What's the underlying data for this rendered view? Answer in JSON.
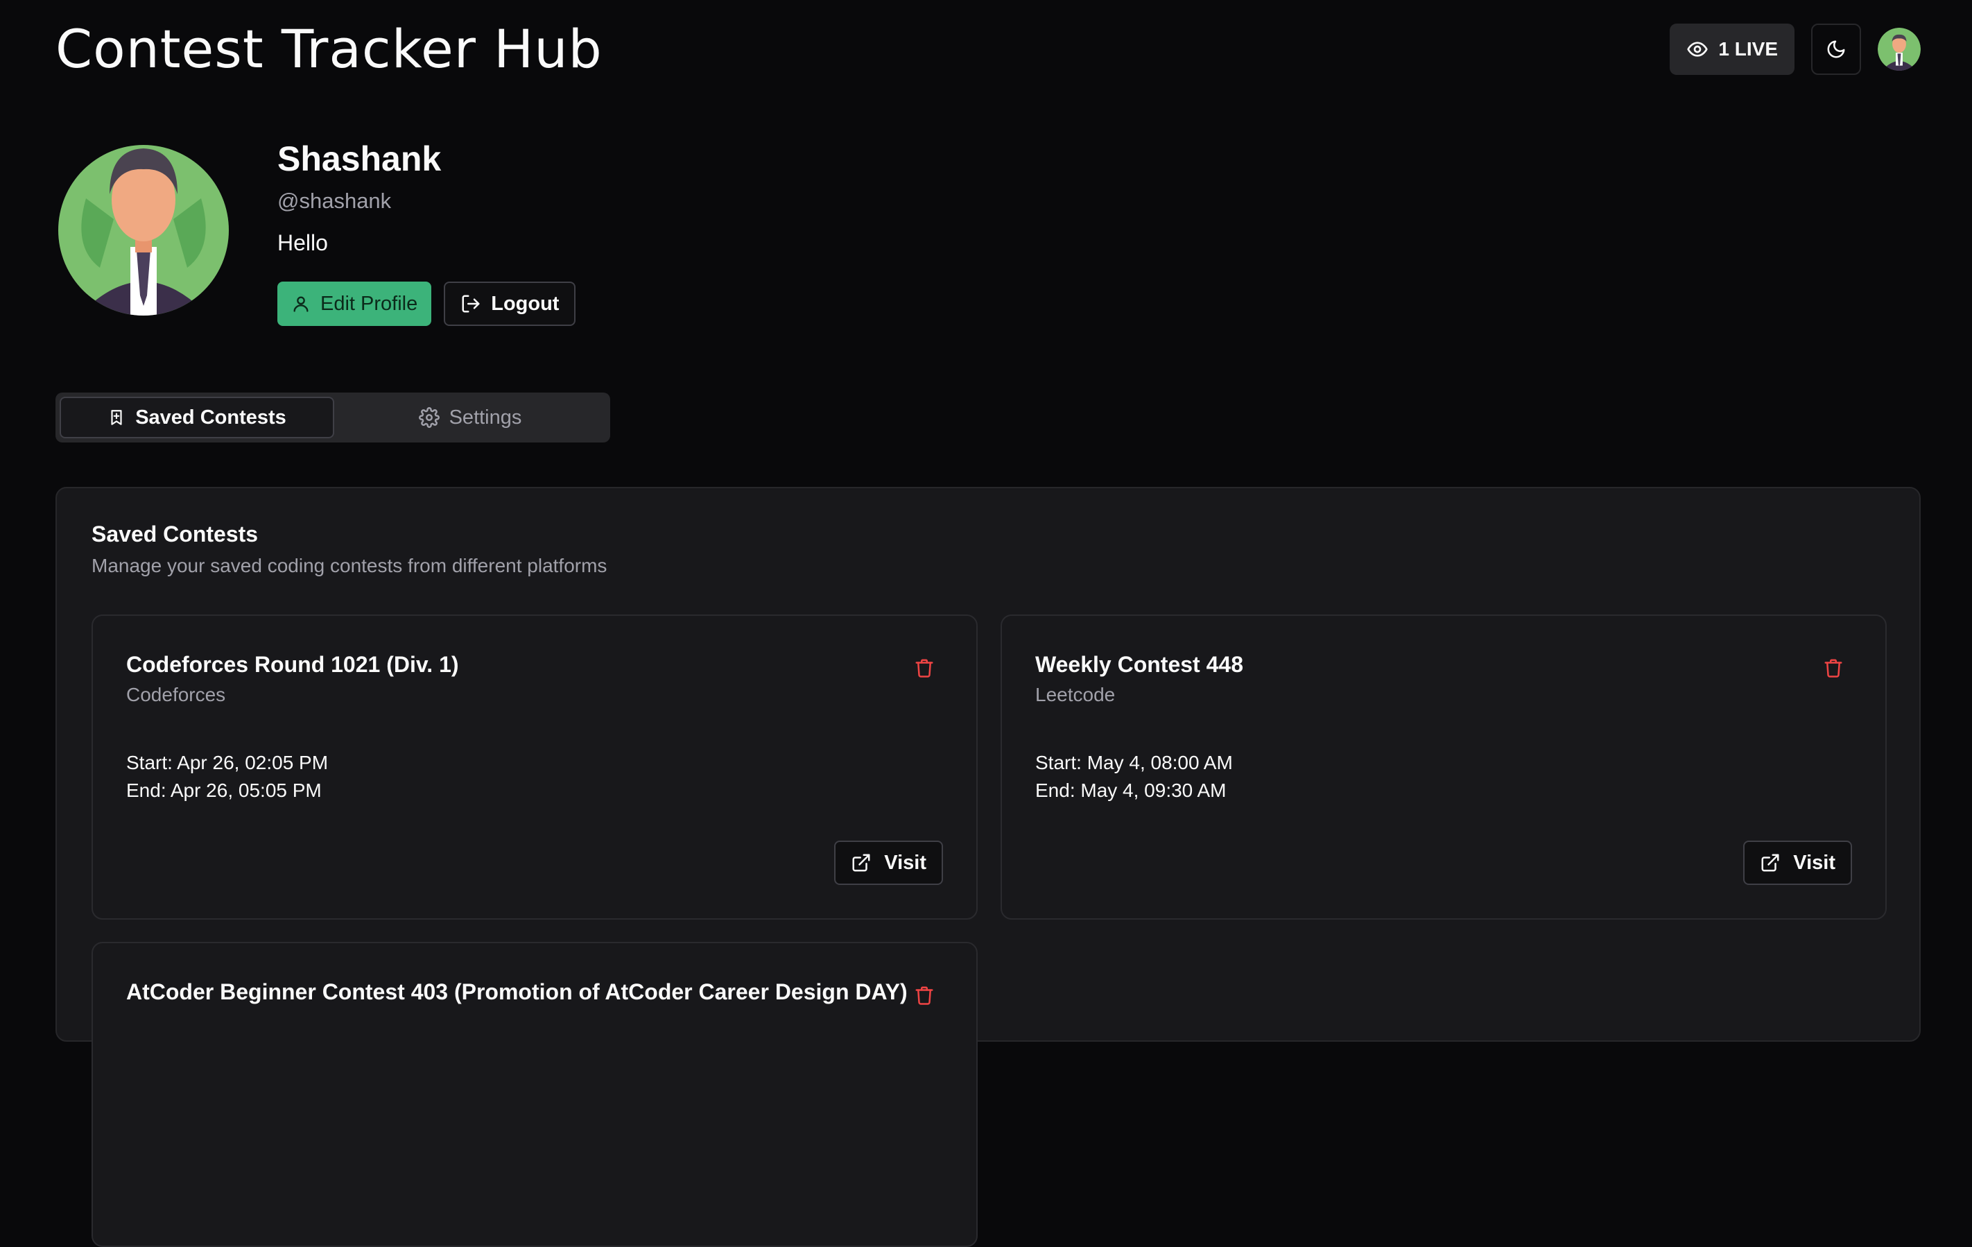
{
  "header": {
    "app_title": "Contest Tracker Hub",
    "live_label": "1 LIVE"
  },
  "profile": {
    "name": "Shashank",
    "handle": "@shashank",
    "bio": "Hello",
    "edit_label": "Edit Profile",
    "logout_label": "Logout"
  },
  "tabs": [
    {
      "label": "Saved Contests",
      "active": true
    },
    {
      "label": "Settings",
      "active": false
    }
  ],
  "saved": {
    "title": "Saved Contests",
    "subtitle": "Manage your saved coding contests from different platforms",
    "cards": [
      {
        "title": "Codeforces Round 1021 (Div. 1)",
        "platform": "Codeforces",
        "start": "Start: Apr 26, 02:05 PM",
        "end": "End: Apr 26, 05:05 PM",
        "visit_label": "Visit"
      },
      {
        "title": "Weekly Contest 448",
        "platform": "Leetcode",
        "start": "Start: May 4, 08:00 AM",
        "end": "End: May 4, 09:30 AM",
        "visit_label": "Visit"
      },
      {
        "title": "AtCoder Beginner Contest 403  (Promotion of AtCoder Career Design DAY)",
        "platform": "",
        "start": "",
        "end": "",
        "visit_label": ""
      }
    ]
  },
  "colors": {
    "background": "#09090b",
    "accent_green": "#3cb37a",
    "trash_red": "#ef4444"
  },
  "icons": {
    "live": "eye-icon",
    "theme": "moon-icon",
    "edit": "user-icon",
    "logout": "logout-icon",
    "saved_tab": "bookmark-icon",
    "settings_tab": "gear-icon",
    "delete": "trash-icon",
    "visit": "external-link-icon"
  }
}
